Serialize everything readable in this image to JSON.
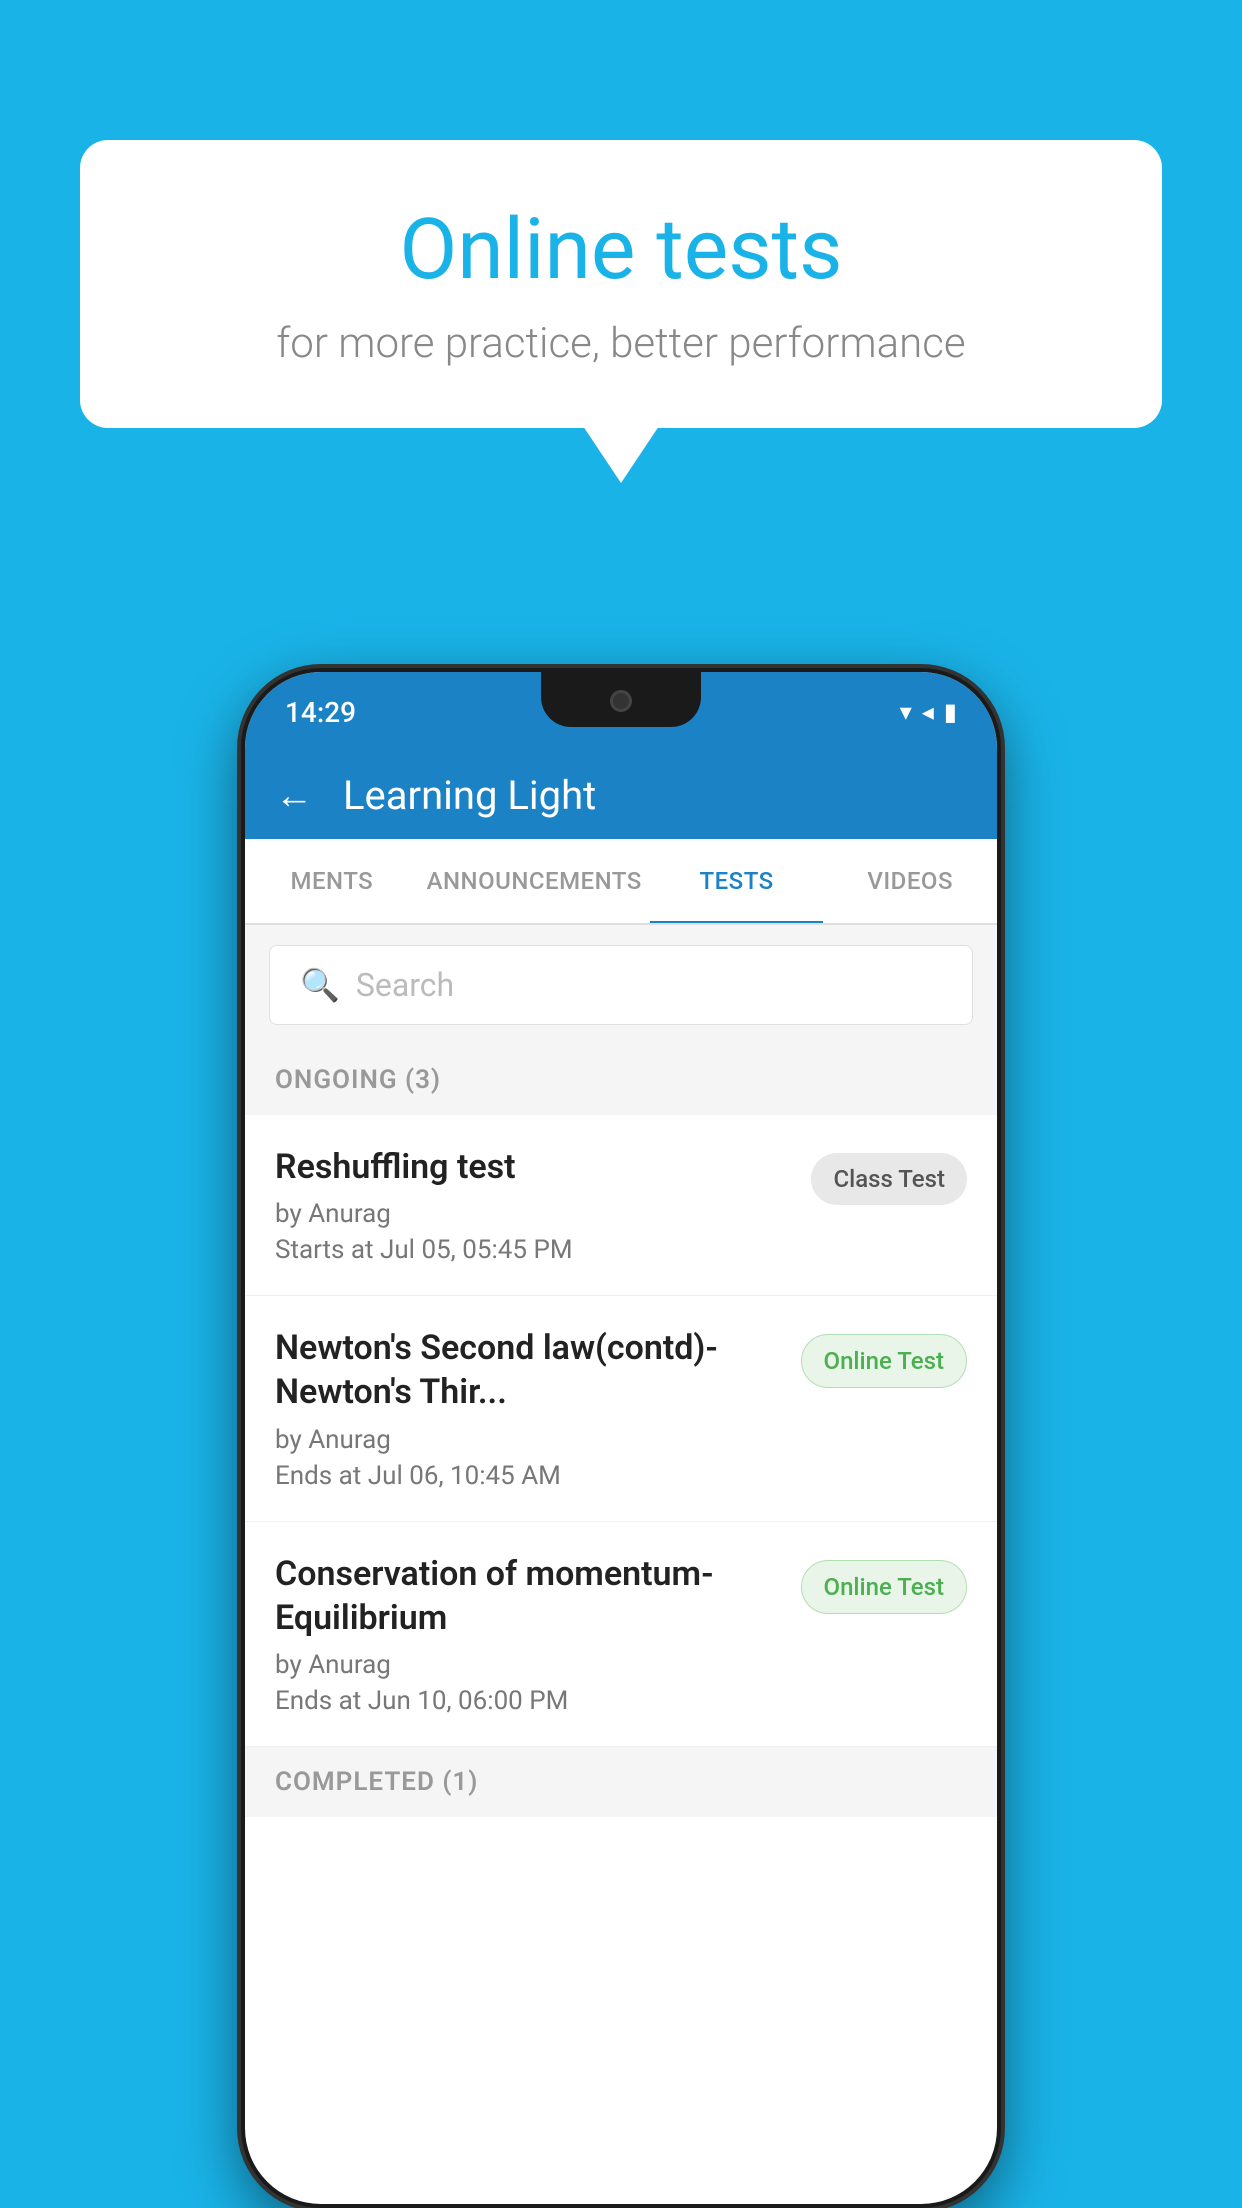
{
  "background_color": "#1ab3e8",
  "speech_bubble": {
    "title": "Online tests",
    "subtitle": "for more practice, better performance"
  },
  "phone": {
    "status_bar": {
      "time": "14:29",
      "wifi_icon": "▼",
      "signal_icon": "◄",
      "battery_icon": "▮"
    },
    "header": {
      "back_label": "←",
      "title": "Learning Light"
    },
    "tabs": [
      {
        "label": "MENTS",
        "active": false
      },
      {
        "label": "ANNOUNCEMENTS",
        "active": false
      },
      {
        "label": "TESTS",
        "active": true
      },
      {
        "label": "VIDEOS",
        "active": false
      }
    ],
    "search": {
      "placeholder": "Search"
    },
    "ongoing_section": {
      "title": "ONGOING (3)",
      "tests": [
        {
          "name": "Reshuffling test",
          "author": "by Anurag",
          "date": "Starts at  Jul 05, 05:45 PM",
          "badge": "Class Test",
          "badge_type": "class"
        },
        {
          "name": "Newton's Second law(contd)-Newton's Thir...",
          "author": "by Anurag",
          "date": "Ends at  Jul 06, 10:45 AM",
          "badge": "Online Test",
          "badge_type": "online"
        },
        {
          "name": "Conservation of momentum-Equilibrium",
          "author": "by Anurag",
          "date": "Ends at  Jun 10, 06:00 PM",
          "badge": "Online Test",
          "badge_type": "online"
        }
      ]
    },
    "completed_section": {
      "title": "COMPLETED (1)"
    }
  }
}
